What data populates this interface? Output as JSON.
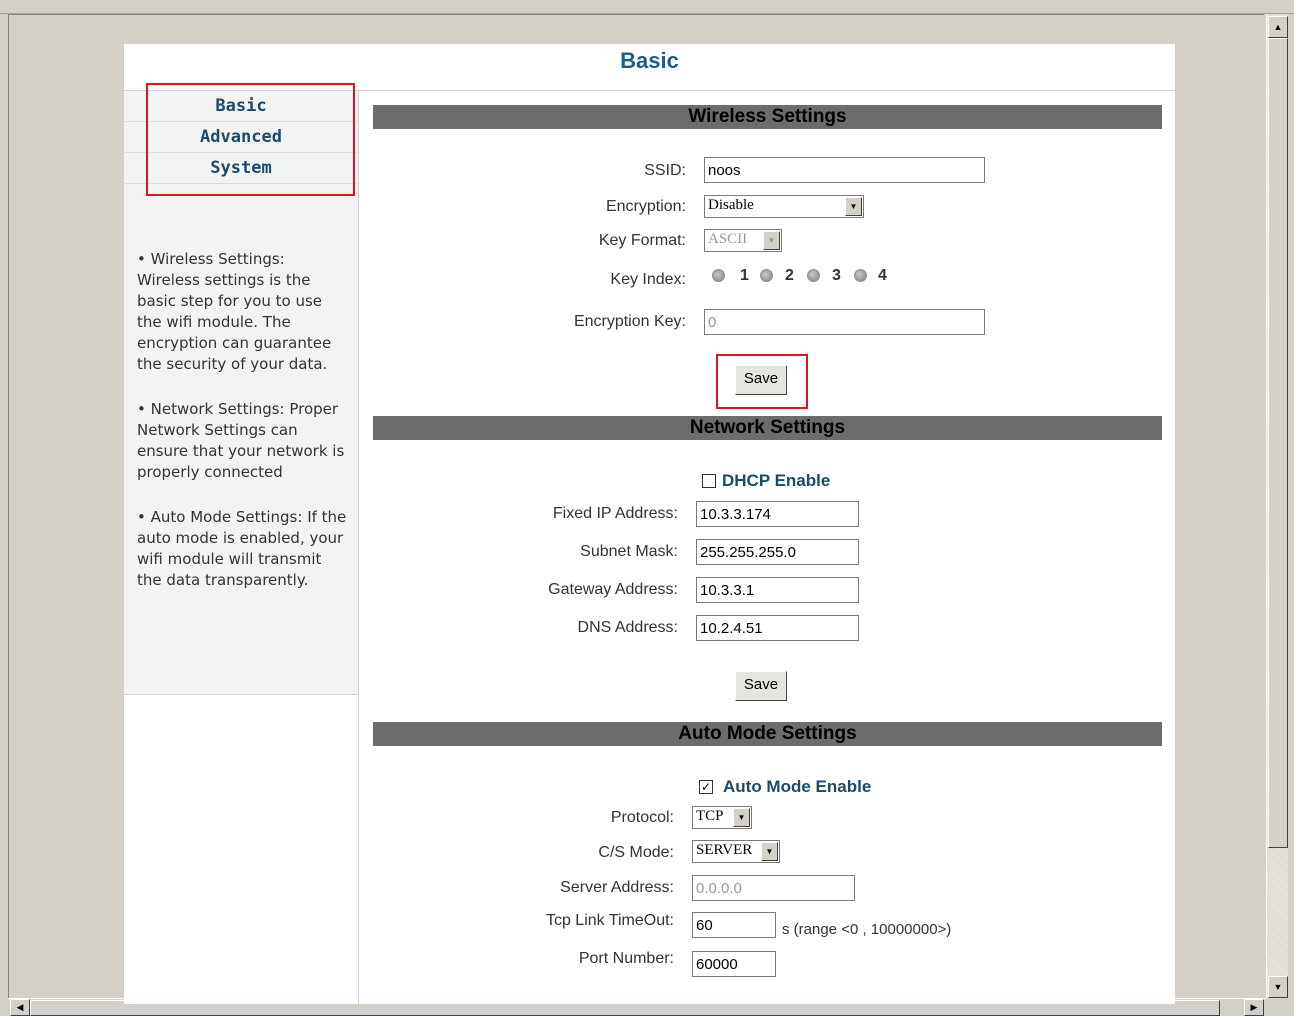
{
  "page": {
    "title": "Basic"
  },
  "sidebar": {
    "items": [
      {
        "label": "Basic"
      },
      {
        "label": "Advanced"
      },
      {
        "label": "System"
      }
    ],
    "help": [
      "• Wireless Settings: Wireless settings is the basic step for you to use the wifi module. The encryption can guarantee the security of your data.",
      "• Network Settings: Proper Network Settings can ensure that your network is properly connected",
      "• Auto Mode Settings: If the auto mode is enabled, your wifi module will transmit the data transparently."
    ]
  },
  "wireless": {
    "heading": "Wireless Settings",
    "ssid_label": "SSID:",
    "ssid_value": "noos",
    "encryption_label": "Encryption:",
    "encryption_value": "Disable",
    "key_format_label": "Key Format:",
    "key_format_value": "ASCII",
    "key_index_label": "Key Index:",
    "key_index_options": [
      "1",
      "2",
      "3",
      "4"
    ],
    "encryption_key_label": "Encryption Key:",
    "encryption_key_value": "0",
    "save_label": "Save"
  },
  "network": {
    "heading": "Network Settings",
    "dhcp_label": "DHCP Enable",
    "dhcp_checked": false,
    "ip_label": "Fixed IP Address:",
    "ip_value": "10.3.3.174",
    "mask_label": "Subnet Mask:",
    "mask_value": "255.255.255.0",
    "gateway_label": "Gateway Address:",
    "gateway_value": "10.3.3.1",
    "dns_label": "DNS Address:",
    "dns_value": "10.2.4.51",
    "save_label": "Save"
  },
  "auto_mode": {
    "heading": "Auto Mode Settings",
    "enable_label": "Auto Mode Enable",
    "enable_checked": true,
    "protocol_label": "Protocol:",
    "protocol_value": "TCP",
    "cs_mode_label": "C/S Mode:",
    "cs_mode_value": "SERVER",
    "server_label": "Server Address:",
    "server_value": "0.0.0.0",
    "timeout_label": "Tcp Link TimeOut:",
    "timeout_value": "60",
    "timeout_hint": "s (range <0 , 10000000>)",
    "port_label": "Port Number:",
    "port_value": "60000"
  },
  "colors": {
    "accent": "#1a5c8c",
    "section_bar": "#6c6c6c",
    "highlight": "#e0141c"
  }
}
